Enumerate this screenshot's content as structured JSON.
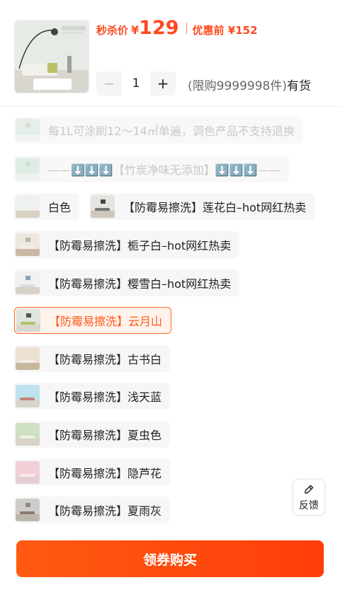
{
  "product": {
    "thumb_label": "云月山"
  },
  "price": {
    "tag": "秒杀价",
    "currency": "¥",
    "value": "129",
    "original": "优惠前 ¥152"
  },
  "quantity": {
    "minus": "−",
    "value": "1",
    "plus": "+"
  },
  "stock": {
    "limit": "(限购9999998件)",
    "status": "有货"
  },
  "options": [
    {
      "label": "每1L可涂刷12～14㎡单遍，调色产品不支持退换",
      "state": "disabled",
      "swatch": "#cfe3d6"
    },
    {
      "label": "——⬇️⬇️⬇️【竹炭净味无添加】⬇️⬇️⬇️——",
      "state": "disabled",
      "swatch": "#bfe0cc"
    },
    {
      "label": "白色",
      "state": "normal",
      "swatch": "#eef1f1"
    },
    {
      "label": "【防霉易擦洗】莲花白–hot网红热卖",
      "state": "normal",
      "swatch": "#e6e4df"
    },
    {
      "label": "【防霉易擦洗】栀子白–hot网红热卖",
      "state": "normal",
      "swatch": "#ede7de"
    },
    {
      "label": "【防霉易擦洗】樱雪白–hot网红热卖",
      "state": "normal",
      "swatch": "#eef0f1"
    },
    {
      "label": "【防霉易擦洗】云月山",
      "state": "selected",
      "swatch": "#dfe4dc"
    },
    {
      "label": "【防霉易擦洗】古书白",
      "state": "normal",
      "swatch": "#ece1d2"
    },
    {
      "label": "【防霉易擦洗】浅天蓝",
      "state": "normal",
      "swatch": "#bfe3ee"
    },
    {
      "label": "【防霉易擦洗】夏虫色",
      "state": "normal",
      "swatch": "#cfe0c4"
    },
    {
      "label": "【防霉易擦洗】隐芦花",
      "state": "normal",
      "swatch": "#f2cfd6"
    },
    {
      "label": "【防霉易擦洗】夏雨灰",
      "state": "normal",
      "swatch": "#cfcdc9"
    }
  ],
  "feedback": {
    "label": "反馈"
  },
  "cta": {
    "label": "领券购买"
  },
  "colors": {
    "accent": "#ff4a1f",
    "selected_border": "#ff6a2a"
  }
}
